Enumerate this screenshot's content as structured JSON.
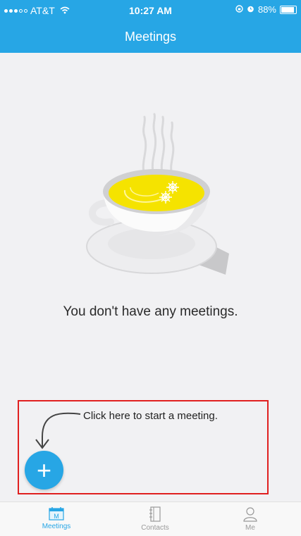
{
  "status_bar": {
    "carrier": "AT&T",
    "time": "10:27 AM",
    "battery_percent": "88%",
    "battery_level": 0.88,
    "signal_bars": 3,
    "signal_total": 5
  },
  "header": {
    "title": "Meetings"
  },
  "empty_state": {
    "message": "You don't have any meetings.",
    "illustration": "tea-cup-icon"
  },
  "hint": {
    "text": "Click here to start a meeting."
  },
  "fab": {
    "label": "+",
    "icon": "plus-icon"
  },
  "tabs": [
    {
      "label": "Meetings",
      "icon": "calendar-icon",
      "active": true
    },
    {
      "label": "Contacts",
      "icon": "contacts-book-icon",
      "active": false
    },
    {
      "label": "Me",
      "icon": "person-icon",
      "active": false
    }
  ],
  "colors": {
    "accent": "#27a6e5",
    "annotation": "#e02020",
    "background": "#f1f1f3"
  }
}
